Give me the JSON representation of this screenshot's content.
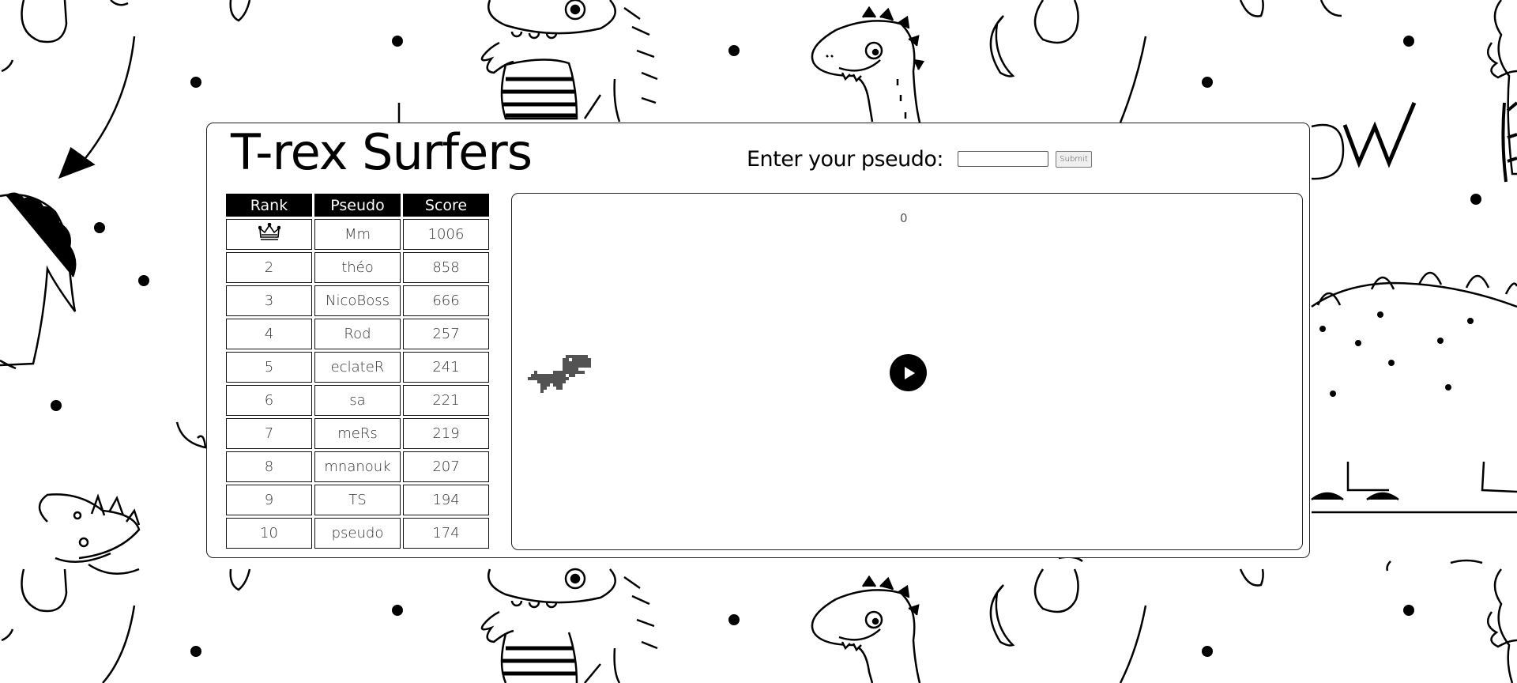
{
  "title": "T-rex Surfers",
  "form": {
    "label": "Enter your pseudo:",
    "input_value": "",
    "submit_label": "Submit"
  },
  "leaderboard": {
    "headers": [
      "Rank",
      "Pseudo",
      "Score"
    ],
    "first_rank_icon": "crown-icon",
    "rows": [
      {
        "rank": "1",
        "pseudo": "Mm",
        "score": "1006"
      },
      {
        "rank": "2",
        "pseudo": "théo",
        "score": "858"
      },
      {
        "rank": "3",
        "pseudo": "NicoBoss",
        "score": "666"
      },
      {
        "rank": "4",
        "pseudo": "Rod",
        "score": "257"
      },
      {
        "rank": "5",
        "pseudo": "eclateR",
        "score": "241"
      },
      {
        "rank": "6",
        "pseudo": "sa",
        "score": "221"
      },
      {
        "rank": "7",
        "pseudo": "meRs",
        "score": "219"
      },
      {
        "rank": "8",
        "pseudo": "mnanouk",
        "score": "207"
      },
      {
        "rank": "9",
        "pseudo": "TS",
        "score": "194"
      },
      {
        "rank": "10",
        "pseudo": "pseudo",
        "score": "174"
      }
    ]
  },
  "game": {
    "score": "0",
    "player_icon": "t-rex-icon",
    "play_icon": "play-icon"
  },
  "colors": {
    "primary": "#000000",
    "dino": "#535353",
    "background": "#ffffff"
  }
}
